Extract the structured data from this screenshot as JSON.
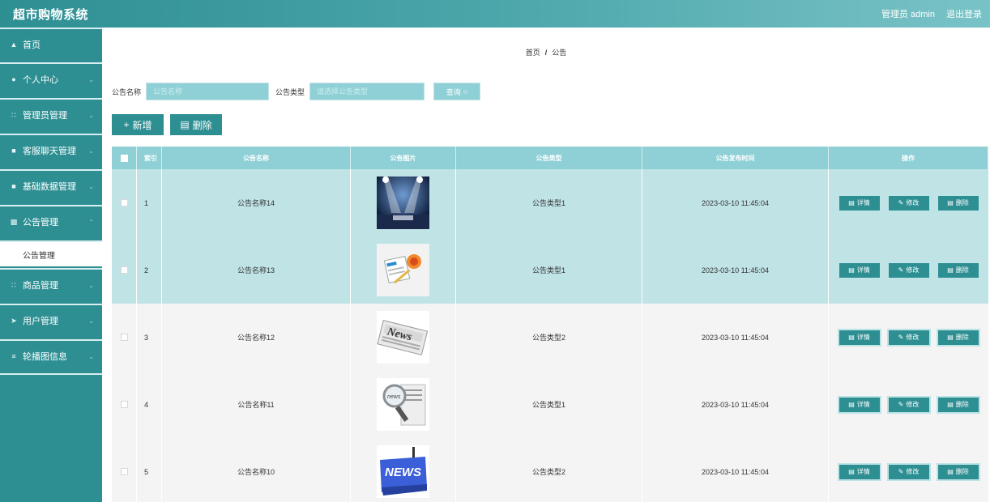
{
  "app": {
    "title": "超市购物系统"
  },
  "header": {
    "user_label": "管理员 admin",
    "logout_label": "退出登录"
  },
  "sidebar": {
    "items": [
      {
        "label": "首页",
        "icon": "home-icon",
        "has_chevron": false
      },
      {
        "label": "个人中心",
        "icon": "user-icon",
        "has_chevron": true
      },
      {
        "label": "管理员管理",
        "icon": "grid-icon",
        "has_chevron": true
      },
      {
        "label": "客服聊天管理",
        "icon": "chat-icon",
        "has_chevron": true
      },
      {
        "label": "基础数据管理",
        "icon": "database-icon",
        "has_chevron": true
      },
      {
        "label": "公告管理",
        "icon": "notice-icon",
        "has_chevron": true,
        "expanded": true
      },
      {
        "label": "商品管理",
        "icon": "grid-icon",
        "has_chevron": true
      },
      {
        "label": "用户管理",
        "icon": "send-icon",
        "has_chevron": true
      },
      {
        "label": "轮播图信息",
        "icon": "sliders-icon",
        "has_chevron": true
      }
    ],
    "submenu": {
      "label": "公告管理"
    }
  },
  "breadcrumb": {
    "home": "首页",
    "separator": "/",
    "current": "公告"
  },
  "search": {
    "name_label": "公告名称",
    "name_placeholder": "公告名称",
    "type_label": "公告类型",
    "type_placeholder": "请选择公告类型",
    "button_label": "查询"
  },
  "actions": {
    "add_label": "新增",
    "delete_label": "删除"
  },
  "table": {
    "headers": {
      "index": "索引",
      "name": "公告名称",
      "image": "公告图片",
      "type": "公告类型",
      "time": "公告发布时间",
      "ops": "操作"
    },
    "op_labels": {
      "detail": "详情",
      "edit": "修改",
      "delete": "删除"
    },
    "rows": [
      {
        "index": "1",
        "name": "公告名称14",
        "type": "公告类型1",
        "time": "2023-03-10 11:45:04",
        "image": "stage-lights-image"
      },
      {
        "index": "2",
        "name": "公告名称13",
        "type": "公告类型1",
        "time": "2023-03-10 11:45:04",
        "image": "news-icons-image"
      },
      {
        "index": "3",
        "name": "公告名称12",
        "type": "公告类型2",
        "time": "2023-03-10 11:45:04",
        "image": "newspaper-image"
      },
      {
        "index": "4",
        "name": "公告名称11",
        "type": "公告类型1",
        "time": "2023-03-10 11:45:04",
        "image": "magnifier-news-image"
      },
      {
        "index": "5",
        "name": "公告名称10",
        "type": "公告类型2",
        "time": "2023-03-10 11:45:04",
        "image": "news-key-image"
      }
    ]
  },
  "colors": {
    "primary": "#2e8f93",
    "light": "#8fd0d6",
    "selected_row": "#c0e3e6",
    "row": "#f4f4f4"
  }
}
